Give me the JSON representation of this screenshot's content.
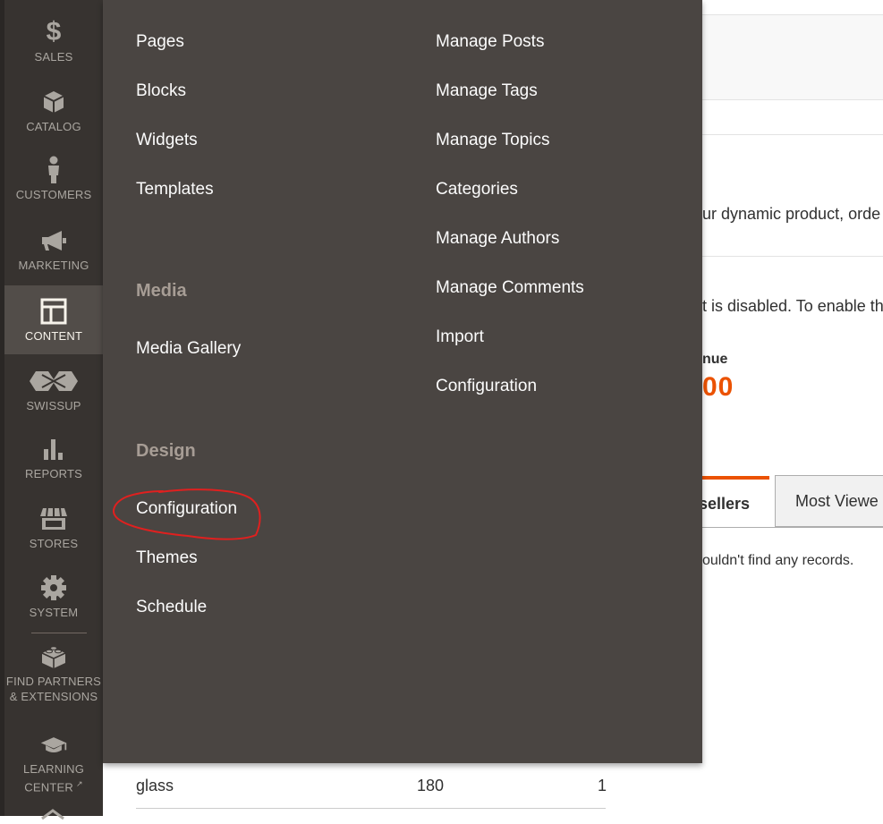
{
  "sidebar": {
    "items": [
      {
        "label": "SALES",
        "icon": "dollar-icon"
      },
      {
        "label": "CATALOG",
        "icon": "box-icon"
      },
      {
        "label": "CUSTOMERS",
        "icon": "person-icon"
      },
      {
        "label": "MARKETING",
        "icon": "megaphone-icon"
      },
      {
        "label": "CONTENT",
        "icon": "layout-icon"
      },
      {
        "label": "SWISSUP",
        "icon": "swissup-logo-icon"
      },
      {
        "label": "REPORTS",
        "icon": "bar-chart-icon"
      },
      {
        "label": "STORES",
        "icon": "storefront-icon"
      },
      {
        "label": "SYSTEM",
        "icon": "gear-icon"
      },
      {
        "label_line1": "FIND PARTNERS",
        "label_line2": "& EXTENSIONS",
        "icon": "lego-brick-icon"
      },
      {
        "label_line1": "LEARNING",
        "label_line2": "CENTER",
        "icon": "graduation-cap-icon"
      }
    ],
    "active": "CONTENT"
  },
  "flyout": {
    "left_column": {
      "elements_links": [
        "Pages",
        "Blocks",
        "Widgets",
        "Templates"
      ],
      "media_heading": "Media",
      "media_links": [
        "Media Gallery"
      ],
      "design_heading": "Design",
      "design_links": [
        "Configuration",
        "Themes",
        "Schedule"
      ]
    },
    "right_column": {
      "links": [
        "Manage Posts",
        "Manage Tags",
        "Manage Topics",
        "Categories",
        "Manage Authors",
        "Manage Comments",
        "Import",
        "Configuration"
      ]
    }
  },
  "background_page": {
    "dynamic_text": "ur dynamic product, orde",
    "disabled_text": "t is disabled. To enable th",
    "revenue_label": "nue",
    "revenue_value": "00",
    "tab_bestsellers": "sellers",
    "tab_most_viewed": "Most Viewe",
    "no_records": "ouldn't find any records.",
    "table_row": {
      "name": "glass",
      "qty": "180",
      "count": "1"
    }
  },
  "colors": {
    "sidebar_bg": "#373330",
    "flyout_bg": "#4a4542",
    "active_item_bg": "#524d49",
    "accent_orange": "#eb5202",
    "annotation_red": "#e0201f"
  }
}
